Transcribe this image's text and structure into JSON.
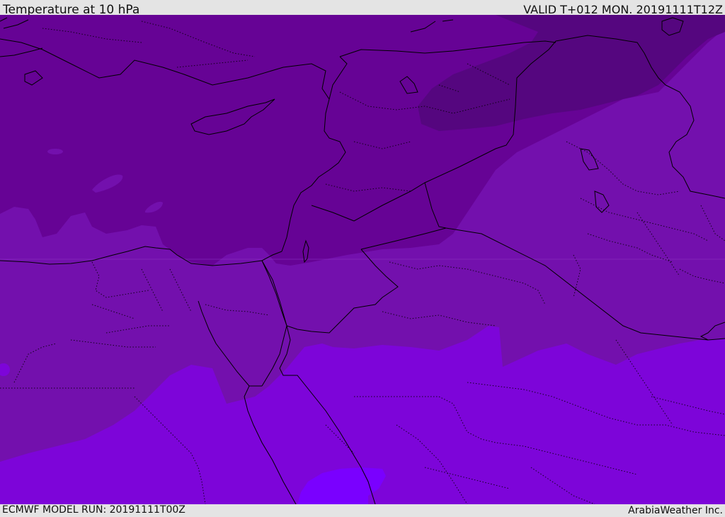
{
  "header": {
    "title": "Temperature at 10 hPa",
    "valid_time": "VALID T+012 MON. 20191111T12Z"
  },
  "footer": {
    "model_run": "ECMWF MODEL RUN: 20191111T00Z",
    "credit": "ArabiaWeather Inc."
  },
  "map": {
    "region": "Eastern Mediterranean / Middle East",
    "shading_colors": {
      "darkest": "#55067f",
      "dark": "#660395",
      "medium": "#7310ad",
      "light": "#7d05d9",
      "lightest": "#7a00ff"
    },
    "boundary_color": "#000000"
  }
}
